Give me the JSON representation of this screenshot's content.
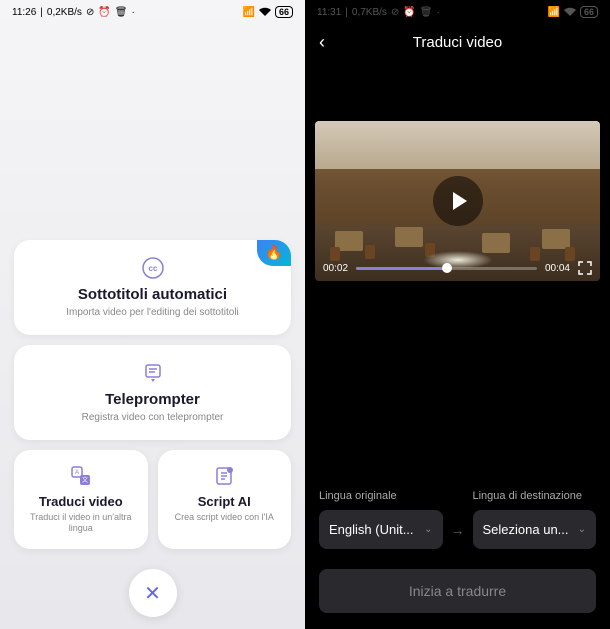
{
  "left": {
    "status": {
      "time": "11:26",
      "speed": "0,2KB/s",
      "battery": "66"
    },
    "cards": {
      "subtitles": {
        "title": "Sottotitoli automatici",
        "subtitle": "Importa video per l'editing dei sottotitoli"
      },
      "teleprompter": {
        "title": "Teleprompter",
        "subtitle": "Registra video con teleprompter"
      },
      "translate": {
        "title": "Traduci video",
        "subtitle": "Traduci il video in un'altra lingua"
      },
      "script": {
        "title": "Script AI",
        "subtitle": "Crea script video con l'IA"
      }
    }
  },
  "right": {
    "status": {
      "time": "11:31",
      "speed": "0,7KB/s",
      "battery": "66"
    },
    "header": {
      "title": "Traduci video"
    },
    "video": {
      "current_time": "00:02",
      "duration": "00:04"
    },
    "language": {
      "source_label": "Lingua originale",
      "target_label": "Lingua di destinazione",
      "source_value": "English (Unit...",
      "target_value": "Seleziona un..."
    },
    "translate_button": "Inizia a tradurre"
  }
}
